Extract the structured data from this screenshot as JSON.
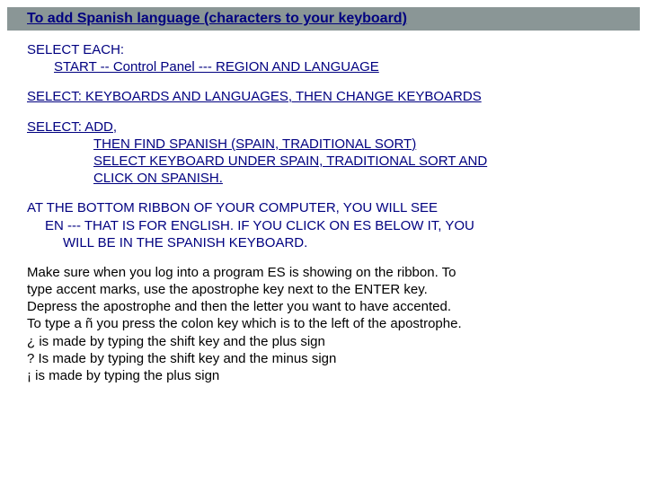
{
  "title": "To add Spanish language (characters to your keyboard)",
  "step1": {
    "head": "SELECT EACH:",
    "line": "START --  Control Panel  ---  REGION AND LANGUAGE"
  },
  "step2": {
    "text": "SELECT:  KEYBOARDS AND LANGUAGES, THEN  CHANGE KEYBOARDS"
  },
  "step3": {
    "head": "SELECT:   ADD,",
    "l1": "THEN FIND  SPANISH (SPAIN, TRADITIONAL SORT)",
    "l2": "SELECT  KEYBOARD UNDER SPAIN, TRADITIONAL SORT AND",
    "l3": "CLICK ON SPANISH."
  },
  "ribbon": {
    "l1": "AT THE BOTTOM RIBBON OF YOUR COMPUTER, YOU WILL SEE",
    "l2": "EN --- THAT IS FOR ENGLISH.  IF YOU CLICK ON ES BELOW IT, YOU",
    "l3": "WILL BE IN THE SPANISH KEYBOARD."
  },
  "notes": {
    "l1": "Make sure when you log into a program  ES is showing on the ribbon.  To",
    "l2": "type accent marks, use the apostrophe key next to the ENTER key.",
    "l3": "Depress the apostrophe and then the letter you want to have accented.",
    "l4": "To type a ñ you press the colon key which is to the left of the apostrophe.",
    "l5": "¿ is made by typing the shift key and the plus sign",
    "l6": "? Is made by typing the shift key and the minus sign",
    "l7": "¡ is made by typing the plus sign"
  }
}
